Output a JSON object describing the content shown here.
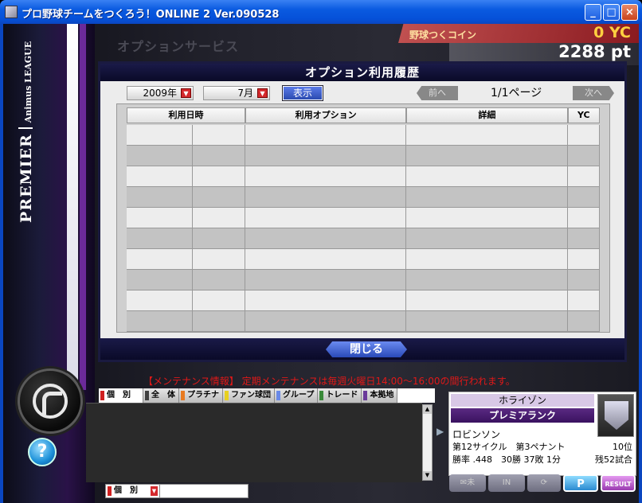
{
  "window": {
    "title": "プロ野球チームをつくろう！ONLINE 2 Ver.090528",
    "min_label": "_",
    "max_label": "□",
    "close_label": "×"
  },
  "league": {
    "premier": "PREMIER",
    "animus": "Animus LEAGUE"
  },
  "header": {
    "service_title": "オプションサービス",
    "coin_label": "野球つくコイン",
    "coin_value": "0 YC",
    "points_value": "2288 pt"
  },
  "panel": {
    "title": "オプション利用履歴",
    "year_select": "2009年",
    "month_select": "7月",
    "show_button": "表示",
    "prev_button": "前へ",
    "page_indicator": "1/1ページ",
    "next_button": "次へ",
    "columns": [
      "利用日時",
      "利用オプション",
      "詳細",
      "YC"
    ],
    "close_button": "閉じる"
  },
  "ticker": "【メンテナンス情報】 定期メンテナンスは毎週火曜日14:00～16:00の間行われます。",
  "chat": {
    "tabs": [
      {
        "label": "個　別",
        "color": "#d02020"
      },
      {
        "label": "全　体",
        "color": "#404040"
      },
      {
        "label": "プラチナ",
        "color": "#e87a20"
      },
      {
        "label": "ファン球団",
        "color": "#e8d020"
      },
      {
        "label": "グループ",
        "color": "#6a8ae8"
      },
      {
        "label": "トレード",
        "color": "#3a8a3a"
      },
      {
        "label": "本拠地",
        "color": "#6a3a9a"
      }
    ],
    "mode": "個　別"
  },
  "profile": {
    "team": "ホライゾン",
    "rank": "プレミアランク",
    "name": "ロビンソン",
    "cycle": "第12サイクル　第3ペナント",
    "position": "10位",
    "record": "勝率 .448　30勝 37敗 1分",
    "remaining": "残52試合"
  },
  "actions": {
    "mail": "✉未",
    "in": "IN",
    "sync": "⟳",
    "p": "P",
    "result": "RESULT"
  }
}
